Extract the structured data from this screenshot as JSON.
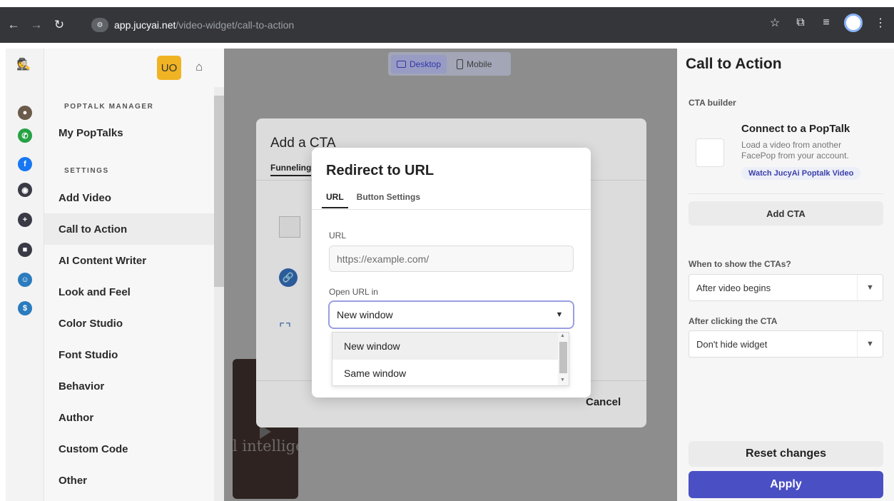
{
  "browser": {
    "url_host": "app.jucyai.net",
    "url_path": "/video-widget/call-to-action",
    "back_icon": "back-arrow-icon",
    "forward_icon": "forward-arrow-icon",
    "reload_icon": "reload-icon"
  },
  "sidebar": {
    "user_initials": "UO",
    "sections": [
      {
        "title": "POPTALK MANAGER"
      },
      {
        "title": "SETTINGS"
      }
    ],
    "items": [
      {
        "label": "My PopTalks"
      },
      {
        "label": "Add Video"
      },
      {
        "label": "Call to Action"
      },
      {
        "label": "AI Content Writer"
      },
      {
        "label": "Look and Feel"
      },
      {
        "label": "Color Studio"
      },
      {
        "label": "Font Studio"
      },
      {
        "label": "Behavior"
      },
      {
        "label": "Author"
      },
      {
        "label": "Custom Code"
      },
      {
        "label": "Other"
      }
    ]
  },
  "preview": {
    "desktop_label": "Desktop",
    "mobile_label": "Mobile",
    "video_text": "l intellige"
  },
  "cta_dialog": {
    "title": "Add a CTA",
    "tab": "Funneling",
    "cancel_label": "Cancel"
  },
  "redirect_modal": {
    "title": "Redirect to URL",
    "tabs": [
      {
        "label": "URL"
      },
      {
        "label": "Button Settings"
      }
    ],
    "url_label": "URL",
    "url_placeholder": "https://example.com/",
    "open_in_label": "Open URL in",
    "open_in_value": "New window",
    "options": [
      {
        "label": "New window"
      },
      {
        "label": "Same window"
      }
    ]
  },
  "right_panel": {
    "title": "Call to Action",
    "builder_label": "CTA builder",
    "card_title": "Connect to a PopTalk",
    "card_desc": "Load a video from another FacePop from your account.",
    "card_link": "Watch JucyAi Poptalk Video",
    "add_cta_label": "Add CTA",
    "show_label": "When to show the CTAs?",
    "show_value": "After video begins",
    "after_click_label": "After clicking the CTA",
    "after_click_value": "Don't hide widget",
    "reset_label": "Reset changes",
    "apply_label": "Apply"
  },
  "colors": {
    "accent": "#4a4fc4",
    "badge": "#f0b323",
    "overlay": "#8d8d8d"
  }
}
